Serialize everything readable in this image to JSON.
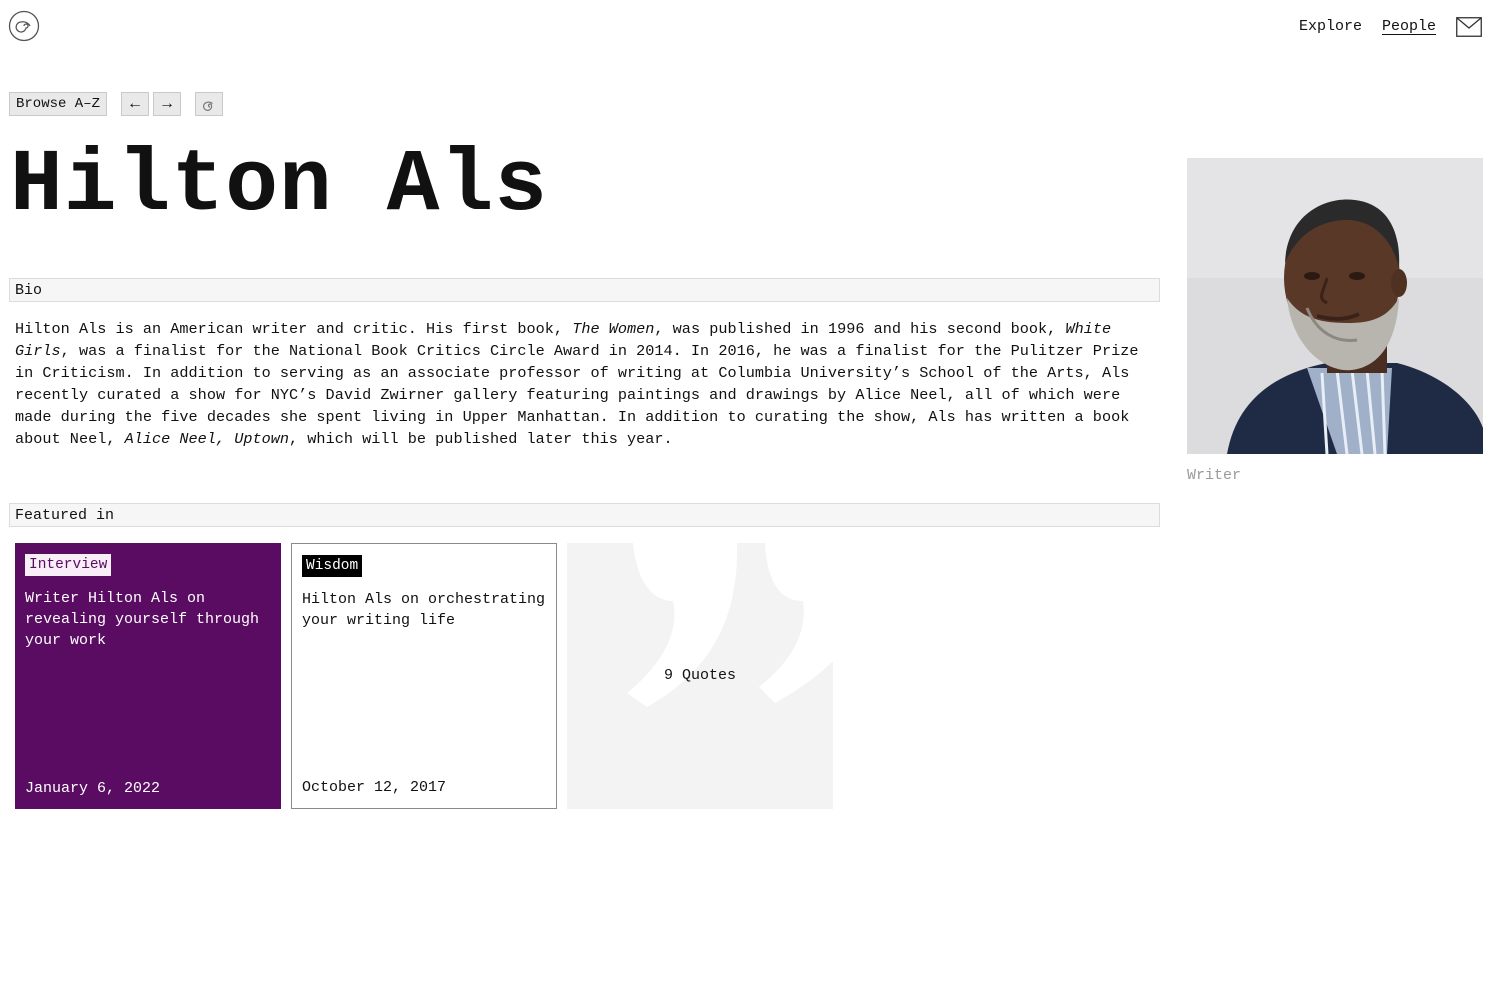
{
  "header": {
    "logo_icon": "spiral-logo-icon",
    "nav": [
      {
        "label": "Explore",
        "active": false
      },
      {
        "label": "People",
        "active": true
      }
    ],
    "mail_icon": "envelope-icon"
  },
  "toolbar": {
    "browse_label": "Browse A–Z",
    "prev_label": "←",
    "next_label": "→",
    "random_icon": "spiral-icon"
  },
  "person": {
    "name": "Hilton Als",
    "role": "Writer",
    "portrait_alt": "Portrait of Hilton Als"
  },
  "bio": {
    "heading": "Bio",
    "segments": [
      {
        "text": "Hilton Als is an American writer and critic. His first book, ",
        "italic": false
      },
      {
        "text": "The Women",
        "italic": true
      },
      {
        "text": ", was published in 1996 and his second book, ",
        "italic": false
      },
      {
        "text": "White Girls",
        "italic": true
      },
      {
        "text": ", was a finalist for the National Book Critics Circle Award in 2014. In 2016, he was a finalist for the Pulitzer Prize in Criticism. In addition to serving as an associate professor of writing at Columbia University’s School of the Arts, Als recently curated a show for NYC’s David Zwirner gallery featuring paintings and drawings by Alice Neel, all of which were made during the five decades she spent living in Upper Manhattan. In addition to curating the show, Als has written a book about Neel, ",
        "italic": false
      },
      {
        "text": "Alice Neel, Uptown",
        "italic": true
      },
      {
        "text": ", which will be published later this year.",
        "italic": false
      }
    ]
  },
  "featured": {
    "heading": "Featured in",
    "cards": [
      {
        "tag": "Interview",
        "title": "Writer Hilton Als on revealing yourself through your work",
        "date": "January 6, 2022"
      },
      {
        "tag": "Wisdom",
        "title": "Hilton Als on orchestrating your writing life",
        "date": "October 12, 2017"
      }
    ],
    "quotes_label": "9 Quotes",
    "quotes_icon": "quotation-mark-icon"
  },
  "colors": {
    "interview_bg": "#5a0c63",
    "wisdom_tag_bg": "#000000",
    "quotes_bg": "#f3f3f3",
    "role_text": "#9a9a9a"
  }
}
